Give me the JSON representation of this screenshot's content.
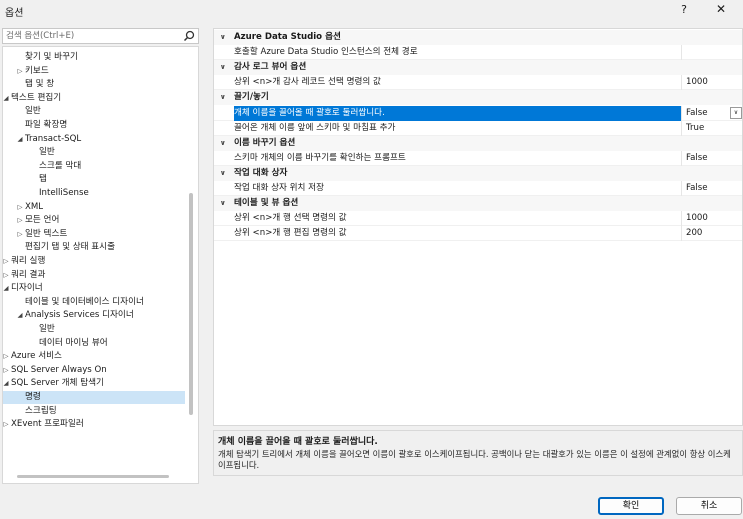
{
  "window": {
    "title": "옵션",
    "help": "?",
    "close": "✕"
  },
  "search": {
    "placeholder": "검색 옵션(Ctrl+E)"
  },
  "tree": {
    "items": [
      {
        "label": "찾기 및 바꾸기",
        "arrow": ""
      },
      {
        "label": "키보드",
        "arrow": "▷"
      },
      {
        "label": "탭 및 창",
        "arrow": ""
      },
      {
        "label": "텍스트 편집기",
        "arrow": "◢"
      },
      {
        "label": "일반",
        "arrow": ""
      },
      {
        "label": "파일 확장명",
        "arrow": ""
      },
      {
        "label": "Transact-SQL",
        "arrow": "◢"
      },
      {
        "label": "일반",
        "arrow": ""
      },
      {
        "label": "스크롤 막대",
        "arrow": ""
      },
      {
        "label": "탭",
        "arrow": ""
      },
      {
        "label": "IntelliSense",
        "arrow": ""
      },
      {
        "label": "XML",
        "arrow": "▷"
      },
      {
        "label": "모든 언어",
        "arrow": "▷"
      },
      {
        "label": "일반 텍스트",
        "arrow": "▷"
      },
      {
        "label": "편집기 탭 및 상태 표시줄",
        "arrow": ""
      },
      {
        "label": "쿼리 실행",
        "arrow": "▷"
      },
      {
        "label": "쿼리 결과",
        "arrow": "▷"
      },
      {
        "label": "디자이너",
        "arrow": "◢"
      },
      {
        "label": "테이블 및 데이터베이스 디자이너",
        "arrow": ""
      },
      {
        "label": "Analysis Services 디자이너",
        "arrow": "◢"
      },
      {
        "label": "일반",
        "arrow": ""
      },
      {
        "label": "데이터 마이닝 뷰어",
        "arrow": ""
      },
      {
        "label": "Azure 서비스",
        "arrow": "▷"
      },
      {
        "label": "SQL Server Always On",
        "arrow": "▷"
      },
      {
        "label": "SQL Server 개체 탐색기",
        "arrow": "◢"
      },
      {
        "label": "명령",
        "arrow": ""
      },
      {
        "label": "스크립팅",
        "arrow": ""
      },
      {
        "label": "XEvent 프로파일러",
        "arrow": "▷"
      }
    ]
  },
  "grid": {
    "rows": [
      {
        "type": "cat",
        "arrow": "∨",
        "name": "Azure Data Studio 옵션",
        "value": ""
      },
      {
        "type": "prop",
        "name": "호출할 Azure Data Studio 인스턴스의 전체 경로",
        "value": ""
      },
      {
        "type": "cat",
        "arrow": "∨",
        "name": "감사 로그 뷰어 옵션",
        "value": ""
      },
      {
        "type": "prop",
        "name": "상위 <n>개 감사 레코드 선택 명령의 값",
        "value": "1000"
      },
      {
        "type": "cat",
        "arrow": "∨",
        "name": "끌기/놓기",
        "value": ""
      },
      {
        "type": "prop",
        "name": "개체 이름을 끌어올 때 괄호로 둘러쌉니다.",
        "value": "False",
        "selected": true
      },
      {
        "type": "prop",
        "name": "끌어온 개체 이름 앞에 스키마 및 마침표 추가",
        "value": "True"
      },
      {
        "type": "cat",
        "arrow": "∨",
        "name": "이름 바꾸기 옵션",
        "value": ""
      },
      {
        "type": "prop",
        "name": "스키마 개체의 이름 바꾸기를 확인하는 프롬프트",
        "value": "False"
      },
      {
        "type": "cat",
        "arrow": "∨",
        "name": "작업 대화 상자",
        "value": ""
      },
      {
        "type": "prop",
        "name": "작업 대화 상자 위치 저장",
        "value": "False"
      },
      {
        "type": "cat",
        "arrow": "∨",
        "name": "테이블 및 뷰 옵션",
        "value": ""
      },
      {
        "type": "prop",
        "name": "상위 <n>개 행 선택 명령의 값",
        "value": "1000"
      },
      {
        "type": "prop",
        "name": "상위 <n>개 행 편집 명령의 값",
        "value": "200"
      }
    ]
  },
  "description": {
    "title": "개체 이름을 끌어올 때 괄호로 둘러쌉니다.",
    "text": "개체 탐색기 트리에서 개체 이름을 끌어오면 이름이 괄호로 이스케이프됩니다. 공백이나 닫는 대괄호가 있는 이름은 이 설정에 관계없이 항상 이스케이프됩니다."
  },
  "buttons": {
    "ok": "확인",
    "cancel": "취소"
  }
}
